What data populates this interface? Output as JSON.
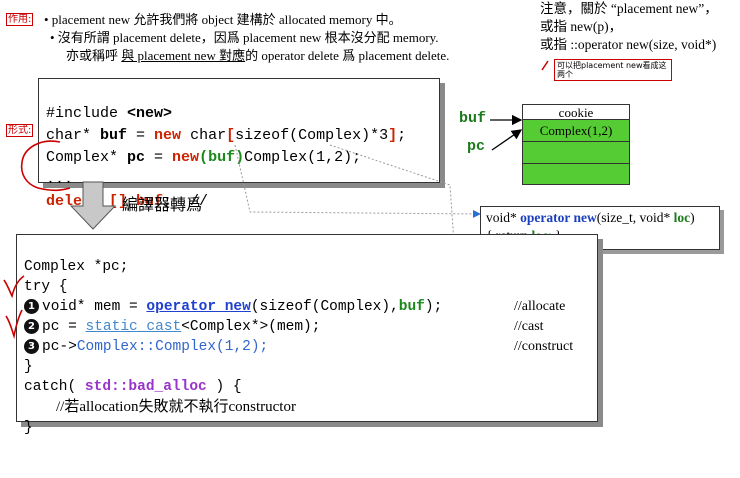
{
  "notes": {
    "tag_purpose": "作用:",
    "bullet1": "• placement new 允許我們將 object 建構於 allocated memory 中。",
    "bullet2": "• 沒有所謂 placement delete，因爲 placement new 根本沒分配 memory.",
    "bullet3_pre": "亦或稱呼 ",
    "bullet3_u": "與 placement new 對應",
    "bullet3_post": "的 operator delete 爲 placement delete."
  },
  "topright": {
    "line1": "注意，關於 “placement new”，",
    "line2": "或指 new(p)，",
    "line3": "或指 ::operator new(size, void*)",
    "handnote": "可以把placement new看成这两个"
  },
  "code1": {
    "tag_form": "形式:",
    "l1_kw": "#include ",
    "l1_hdr": "<new>",
    "l2_a": "char* ",
    "l2_buf": "buf",
    "l2_eq": " = ",
    "l2_new": "new",
    "l2_b": " char",
    "l2_br1": "[",
    "l2_c": "sizeof(Complex)*3",
    "l2_br2": "]",
    "l2_end": ";",
    "l3_a": "Complex* ",
    "l3_pc": "pc",
    "l3_eq": " = ",
    "l3_new": "new",
    "l3_buf": "(buf)",
    "l3_rest": "Complex(1,2);",
    "l4": "...",
    "l5_del": "delete [] buf",
    "l5_rest": ";  //"
  },
  "diagram": {
    "buf_label": "buf",
    "pc_label": "pc",
    "cell_cookie": "cookie",
    "cell_complex": "Complex(1,2)"
  },
  "compiler_label": "編譯器轉爲",
  "opnew": {
    "l1_a": "void* ",
    "l1_kw": "operator new",
    "l1_b": "(size_t, void* ",
    "l1_loc": "loc",
    "l1_c": ")",
    "l2_a": "{  return ",
    "l2_loc": "loc",
    "l2_b": ";  }"
  },
  "code2": {
    "l1": "Complex *pc;",
    "l2": "try {",
    "n1": "1",
    "l3_a": "void* mem = ",
    "l3_op": "operator new",
    "l3_b": "(sizeof(Complex),",
    "l3_buf": "buf",
    "l3_c": ");",
    "l3_cmt": "//allocate",
    "n2": "2",
    "l4_a": "pc = ",
    "l4_sc": "static_cast",
    "l4_b": "<Complex*>(mem);",
    "l4_cmt": "//cast",
    "n3": "3",
    "l5_a": "pc->",
    "l5_b": "Complex::Complex(1,2);",
    "l5_cmt": "//construct",
    "l6": "}",
    "l7_a": "catch( ",
    "l7_exc": "std::bad_alloc",
    "l7_b": " ) {",
    "l8": "//若allocation失敗就不執行constructor",
    "l9": "}"
  }
}
